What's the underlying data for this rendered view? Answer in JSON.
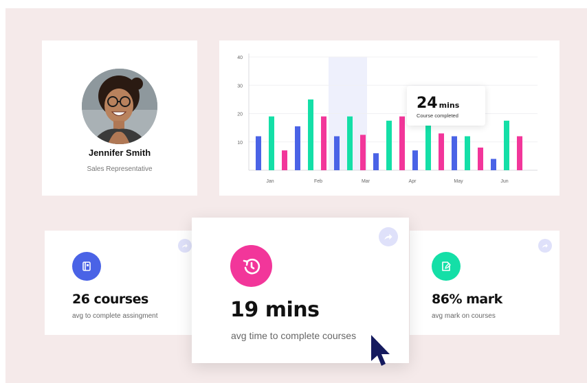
{
  "profile": {
    "name": "Jennifer Smith",
    "role": "Sales Representative"
  },
  "tooltip": {
    "value": "24",
    "unit": "mins",
    "label": "Course completed"
  },
  "chart_data": {
    "type": "bar",
    "y_ticks": [
      "10",
      "20",
      "30",
      "40"
    ],
    "ylim": [
      0,
      40
    ],
    "x_tick_labels": [
      "Jan",
      "Feb",
      "Mar",
      "Apr",
      "May",
      "Jun"
    ],
    "highlight_group": 3,
    "colors": {
      "blue": "#4a63e6",
      "green": "#14dfa7",
      "pink": "#f2369a"
    },
    "groups": [
      {
        "blue": 12,
        "green": 19,
        "pink": 7
      },
      {
        "blue": 15.5,
        "green": 25,
        "pink": 19
      },
      {
        "blue": 12,
        "green": 19,
        "pink": 12.5
      },
      {
        "blue": 6,
        "green": 17.5,
        "pink": 19
      },
      {
        "blue": 7,
        "green": 23,
        "pink": 13
      },
      {
        "blue": 12,
        "green": 12,
        "pink": 8
      },
      {
        "blue": 4,
        "green": 17.5,
        "pink": 12
      }
    ]
  },
  "stats": {
    "left": {
      "value": "26 courses",
      "label": "avg to complete assingment",
      "icon": "book-icon",
      "color": "#4a63e6"
    },
    "center": {
      "value": "19 mins",
      "label": "avg time to complete courses",
      "icon": "clock-refresh-icon",
      "color": "#f2369a"
    },
    "right": {
      "value": "86% mark",
      "label": "avg mark on courses",
      "icon": "edit-document-icon",
      "color": "#14dfa7"
    }
  }
}
